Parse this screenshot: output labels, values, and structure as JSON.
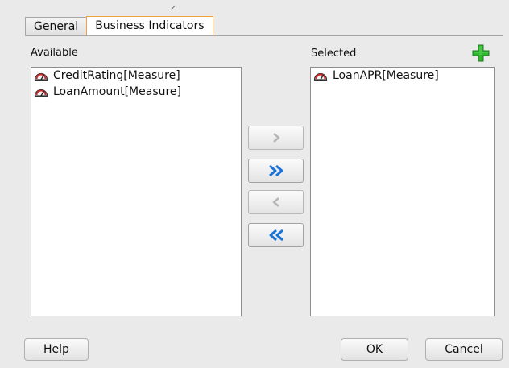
{
  "tabs": [
    {
      "label": "General"
    },
    {
      "label": "Business Indicators"
    }
  ],
  "available": {
    "label": "Available",
    "items": [
      {
        "label": "CreditRating[Measure]",
        "icon": "gauge-icon"
      },
      {
        "label": "LoanAmount[Measure]",
        "icon": "gauge-icon"
      }
    ]
  },
  "selected": {
    "label": "Selected",
    "items": [
      {
        "label": "LoanAPR[Measure]",
        "icon": "gauge-icon"
      }
    ]
  },
  "move_buttons": [
    {
      "name": "move-right",
      "glyph": ">",
      "enabled": false
    },
    {
      "name": "move-all-right",
      "glyph": ">>",
      "enabled": true
    },
    {
      "name": "move-left",
      "glyph": "<",
      "enabled": false
    },
    {
      "name": "move-all-left",
      "glyph": "<<",
      "enabled": true
    }
  ],
  "footer": {
    "help_label": "Help",
    "ok_label": "OK",
    "cancel_label": "Cancel"
  },
  "colors": {
    "active_tab_border": "#f0a23c",
    "arrow_enabled": "#1a73d9",
    "arrow_disabled": "#b5b5b5",
    "add_icon": "#2eb82e"
  }
}
